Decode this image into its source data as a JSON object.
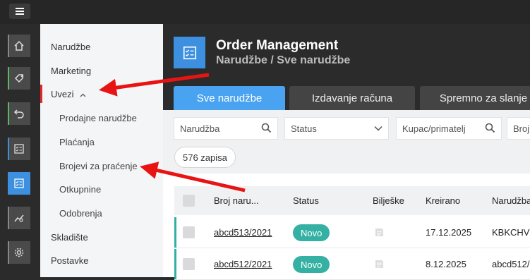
{
  "sidebar": {
    "items": [
      {
        "label": "Narudžbe"
      },
      {
        "label": "Marketing"
      },
      {
        "label": "Uvezi"
      },
      {
        "label": "Skladište"
      },
      {
        "label": "Postavke"
      }
    ],
    "sub_items": [
      {
        "label": "Prodajne narudžbe"
      },
      {
        "label": "Plaćanja"
      },
      {
        "label": "Brojevi za praćenje"
      },
      {
        "label": "Otkupnine"
      },
      {
        "label": "Odobrenja"
      }
    ]
  },
  "header": {
    "title": "Order Management",
    "breadcrumb": "Narudžbe / Sve narudžbe"
  },
  "tabs": [
    {
      "label": "Sve narudžbe"
    },
    {
      "label": "Izdavanje računa"
    },
    {
      "label": "Spremno za slanje"
    }
  ],
  "filters": {
    "order_placeholder": "Narudžba",
    "status_placeholder": "Status",
    "customer_placeholder": "Kupac/primatelj",
    "number_placeholder": "Broj"
  },
  "record_count": "576 zapisa",
  "table": {
    "columns": [
      "Broj naru...",
      "Status",
      "Bilješke",
      "Kreirano",
      "Narudžba"
    ],
    "rows": [
      {
        "number": "abcd513/2021",
        "status": "Novo",
        "created": "17.12.2025",
        "order": "KBKCHVE"
      },
      {
        "number": "abcd512/2021",
        "status": "Novo",
        "created": "8.12.2025",
        "order": "abcd512/"
      }
    ]
  },
  "colors": {
    "accent": "#3d8fe0",
    "tab_active": "#4aa3f0",
    "status_new": "#35b1a4",
    "annotation_arrow": "#e81414"
  },
  "icons": [
    "menu-icon",
    "home-icon",
    "tag-icon",
    "undo-icon",
    "checklist-icon",
    "chart-icon",
    "gear-icon",
    "search-icon",
    "chevron-down-icon",
    "chevron-up-icon",
    "note-icon"
  ]
}
